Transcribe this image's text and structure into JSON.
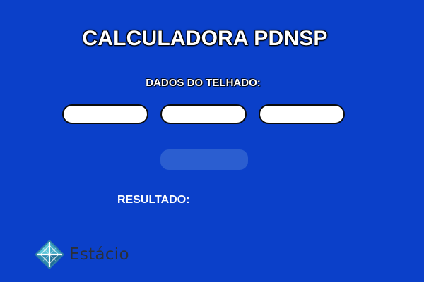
{
  "header": {
    "title": "CALCULADORA PDNSP",
    "subtitle": "DADOS DO TELHADO:"
  },
  "form": {
    "field1": {
      "value": "",
      "placeholder": ""
    },
    "field2": {
      "value": "",
      "placeholder": ""
    },
    "field3": {
      "value": "",
      "placeholder": ""
    },
    "calculate_label": ""
  },
  "result": {
    "label": "RESULTADO:",
    "value": ""
  },
  "footer": {
    "logo_text": "Estácio",
    "logo_icon": "estacio-logo-icon"
  },
  "colors": {
    "background": "#0b40c9",
    "button": "#2b5ed0",
    "text": "#ffffff",
    "field_border": "#0b0b0b",
    "logo_teal": "#3fb0c9"
  }
}
